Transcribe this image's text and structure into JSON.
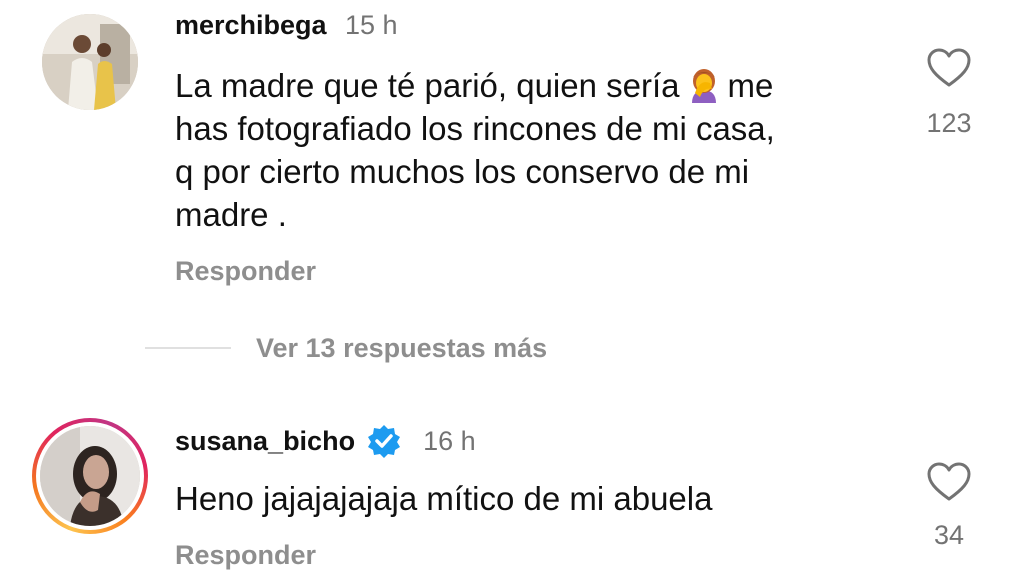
{
  "comments": [
    {
      "username": "merchibega",
      "time": "15 h",
      "text_before_emoji": "La madre que té parió, quien sería",
      "emoji": "woman-facepalming-emoji",
      "text_after_emoji": "me",
      "text_lines": [
        "has fotografiado los rincones de mi casa,",
        "q por cierto muchos los conservo de mi",
        "madre ."
      ],
      "reply_label": "Responder",
      "likes": "123",
      "verified": false
    },
    {
      "username": "susana_bicho",
      "time": "16 h",
      "text": "Heno jajajajajaja mítico de mi abuela",
      "reply_label": "Responder",
      "likes": "34",
      "verified": true
    }
  ],
  "view_more": "Ver 13 respuestas más",
  "colors": {
    "verified_badge": "#1d9bf0",
    "secondary_text": "#737373"
  }
}
